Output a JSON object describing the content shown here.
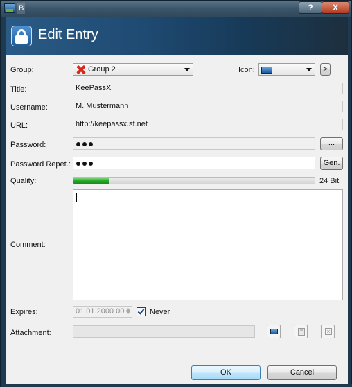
{
  "window": {
    "title": "B",
    "help_label": "?",
    "close_label": "X"
  },
  "header": {
    "title": "Edit Entry"
  },
  "form": {
    "group": {
      "label": "Group:",
      "value": "Group 2"
    },
    "icon": {
      "label": "Icon:",
      "next_label": ">"
    },
    "title": {
      "label": "Title:",
      "value": "KeePassX"
    },
    "username": {
      "label": "Username:",
      "value": "M. Mustermann"
    },
    "url": {
      "label": "URL:",
      "value": "http://keepassx.sf.net"
    },
    "password": {
      "label": "Password:",
      "browse_label": "..."
    },
    "password_repeat": {
      "label": "Password Repet.:",
      "gen_label": "Gen."
    },
    "quality": {
      "label": "Quality:",
      "value_text": "24 Bit",
      "fill_fraction": 0.15
    },
    "comment": {
      "label": "Comment:",
      "value": ""
    },
    "expires": {
      "label": "Expires:",
      "value": "01.01.2000 00",
      "never_label": "Never",
      "never_checked": true
    },
    "attachment": {
      "label": "Attachment:",
      "value": ""
    }
  },
  "buttons": {
    "ok_label": "OK",
    "cancel_label": "Cancel"
  },
  "colors": {
    "header_gradient_start": "#2a5b86",
    "quality_green": "#2aa92a",
    "ok_accent": "#3c7fb1"
  },
  "icons": [
    "app-icon",
    "unlock-icon",
    "red-x-icon",
    "image-icon",
    "save-icon",
    "delete-icon",
    "checkmark-icon"
  ]
}
